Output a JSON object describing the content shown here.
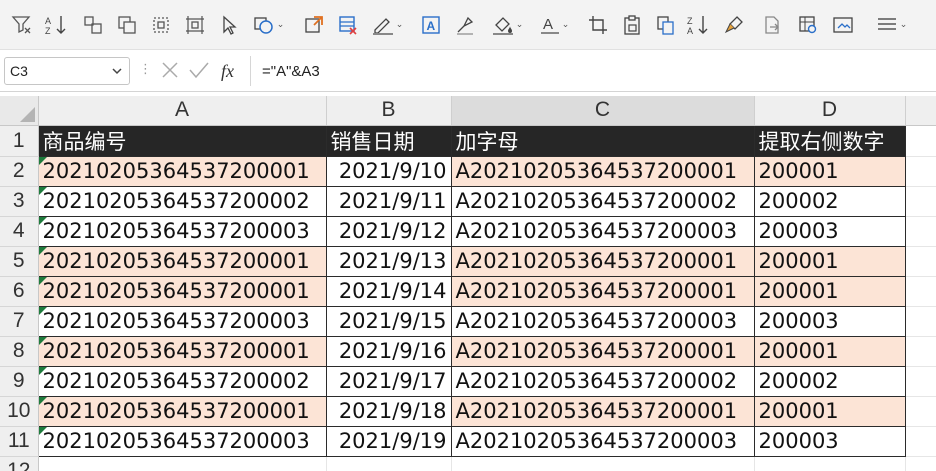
{
  "toolbar": {
    "icons": [
      "filter-clear-icon",
      "sort-az-icon",
      "group-icon",
      "ungroup-icon",
      "select-object-icon",
      "selection-pane-icon",
      "pointer-icon",
      "shapes-icon",
      "insert-picture-icon",
      "table-delete-icon",
      "edit-icon",
      "textbox-icon",
      "format-painter-icon",
      "fill-color-icon",
      "font-color-icon",
      "crop-icon",
      "paste-icon",
      "copy-format-icon",
      "sort-za-icon",
      "brush-icon",
      "export-icon",
      "data-validation-icon",
      "screenshot-icon",
      "menu-icon"
    ]
  },
  "formula_bar": {
    "name_box": "C3",
    "formula": "=\"A\"&A3"
  },
  "columns": [
    "A",
    "B",
    "C",
    "D"
  ],
  "row_numbers": [
    "1",
    "2",
    "3",
    "4",
    "5",
    "6",
    "7",
    "8",
    "9",
    "10",
    "11",
    "12"
  ],
  "header_row": [
    "商品编号",
    "销售日期",
    "加字母",
    "提取右侧数字"
  ],
  "rows": [
    {
      "a": "20210205364537200001",
      "b": "2021/9/10",
      "c": "A20210205364537200001",
      "d": "200001",
      "highlight": true
    },
    {
      "a": "20210205364537200002",
      "b": "2021/9/11",
      "c": "A20210205364537200002",
      "d": "200002",
      "highlight": false
    },
    {
      "a": "20210205364537200003",
      "b": "2021/9/12",
      "c": "A20210205364537200003",
      "d": "200003",
      "highlight": false
    },
    {
      "a": "20210205364537200001",
      "b": "2021/9/13",
      "c": "A20210205364537200001",
      "d": "200001",
      "highlight": true
    },
    {
      "a": "20210205364537200001",
      "b": "2021/9/14",
      "c": "A20210205364537200001",
      "d": "200001",
      "highlight": true
    },
    {
      "a": "20210205364537200003",
      "b": "2021/9/15",
      "c": "A20210205364537200003",
      "d": "200003",
      "highlight": false
    },
    {
      "a": "20210205364537200001",
      "b": "2021/9/16",
      "c": "A20210205364537200001",
      "d": "200001",
      "highlight": true
    },
    {
      "a": "20210205364537200002",
      "b": "2021/9/17",
      "c": "A20210205364537200002",
      "d": "200002",
      "highlight": false
    },
    {
      "a": "20210205364537200001",
      "b": "2021/9/18",
      "c": "A20210205364537200001",
      "d": "200001",
      "highlight": true
    },
    {
      "a": "20210205364537200003",
      "b": "2021/9/19",
      "c": "A20210205364537200003",
      "d": "200003",
      "highlight": false
    }
  ],
  "colors": {
    "header_fill": "#262626",
    "highlight_fill": "#fce4d6",
    "error_indicator": "#1e7b3c"
  }
}
